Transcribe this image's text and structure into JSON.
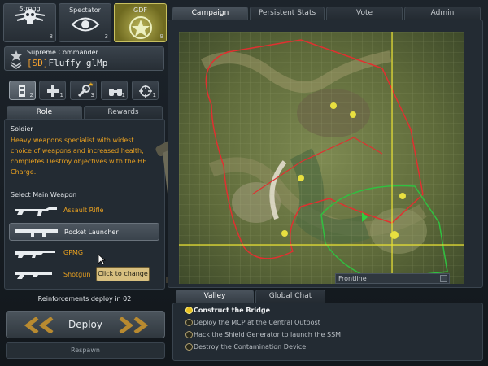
{
  "factions": [
    {
      "name": "Strogg",
      "count": "8",
      "icon": "strogg-skull-icon"
    },
    {
      "name": "Spectator",
      "count": "3",
      "icon": "eye-icon"
    },
    {
      "name": "GDF",
      "count": "9",
      "icon": "gdf-star-icon",
      "active": true
    }
  ],
  "player": {
    "rank": "Supreme Commander",
    "clan_tag": "[SD]",
    "name": "Fluffy_glMp"
  },
  "classes": [
    {
      "icon": "soldier-icon",
      "count": "2"
    },
    {
      "icon": "medic-cross-icon",
      "count": "1"
    },
    {
      "icon": "engineer-wrench-icon",
      "count": "3"
    },
    {
      "icon": "field-ops-binoculars-icon",
      "count": "1"
    },
    {
      "icon": "covert-ops-crosshair-icon",
      "count": "1"
    }
  ],
  "left_tabs": {
    "role": "Role",
    "rewards": "Rewards"
  },
  "role": {
    "title": "Soldier",
    "description": "Heavy weapons specialist with widest choice of weapons and increased health, completes Destroy objectives with the HE Charge."
  },
  "weapons": {
    "header": "Select Main Weapon",
    "items": [
      "Assault Rifle",
      "Rocket Launcher",
      "GPMG",
      "Shotgun"
    ],
    "tooltip": "Click to change"
  },
  "reinforcements": "Reinforcements deploy in 02",
  "deploy_label": "Deploy",
  "respawn_label": "Respawn",
  "top_tabs": [
    "Campaign",
    "Persistent Stats",
    "Vote",
    "Admin"
  ],
  "map": {
    "label": "Frontline"
  },
  "bottom_tabs": [
    "Valley",
    "Global Chat"
  ],
  "objectives": [
    "Construct the Bridge",
    "Deploy the MCP at the Central Outpost",
    "Hack the Shield Generator to launch the SSM",
    "Destroy the Contamination Device"
  ],
  "colors": {
    "accent": "#f0b020",
    "tag": "#f2a030",
    "gdf": "#b8b255"
  }
}
